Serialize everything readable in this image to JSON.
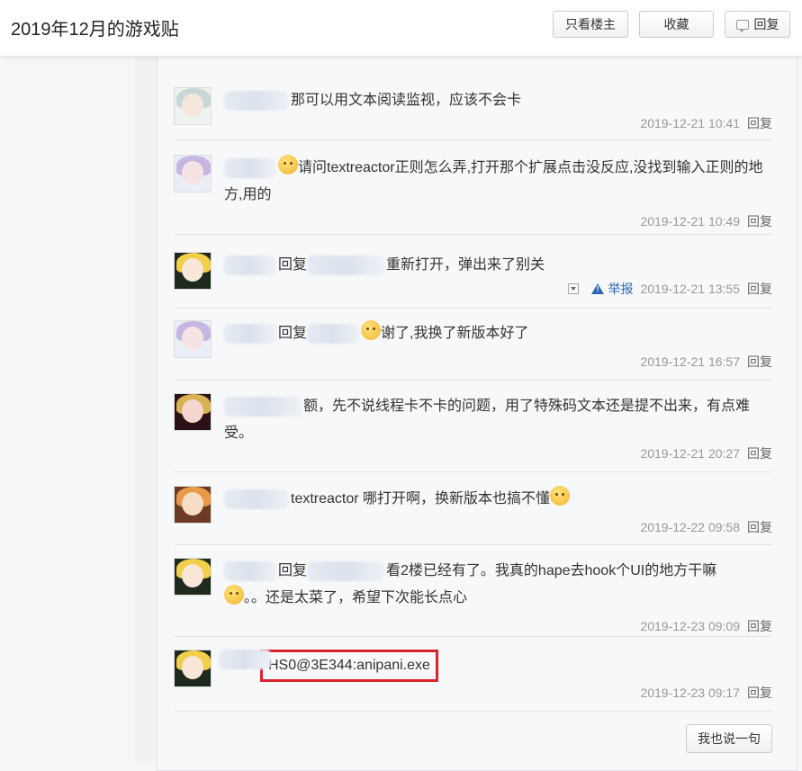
{
  "header": {
    "title": "2019年12月的游戏贴",
    "only_op_label": "只看楼主",
    "favorite_label": "收藏",
    "reply_label": "回复"
  },
  "colors": {
    "link_blue": "#2d64b3",
    "highlight_red": "#d9232d",
    "meta_gray": "#999999"
  },
  "replies": [
    {
      "text": "那可以用文本阅读监视，应该不会卡",
      "time": "2019-12-21 10:41",
      "reply_label": "回复",
      "avatar_icon": "avatar-silver-hair-icon"
    },
    {
      "text": "请问textreactor正则怎么弄,打开那个扩展点击没反应,没找到输入正则的地方,用的",
      "time": "2019-12-21 10:49",
      "reply_label": "回复",
      "avatar_icon": "avatar-purple-hair-icon",
      "emoji_icon": "sweat-emoji-icon"
    },
    {
      "prefix": "回复",
      "text": "重新打开，弹出来了别关",
      "time": "2019-12-21 13:55",
      "reply_label": "回复",
      "report_label": "举报",
      "avatar_icon": "avatar-blonde-hair-icon"
    },
    {
      "prefix": "回复",
      "text": "谢了,我换了新版本好了",
      "time": "2019-12-21 16:57",
      "reply_label": "回复",
      "avatar_icon": "avatar-purple-hair-icon",
      "emoji_icon": "tongue-emoji-icon"
    },
    {
      "text": "额，先不说线程卡不卡的问题，用了特殊码文本还是提不出来，有点难受。",
      "time": "2019-12-21 20:27",
      "reply_label": "回复",
      "avatar_icon": "avatar-red-hair-icon"
    },
    {
      "text": "textreactor 哪打开啊，换新版本也搞不懂",
      "time": "2019-12-22 09:58",
      "reply_label": "回复",
      "avatar_icon": "avatar-orange-hair-icon",
      "emoji_icon": "confused-emoji-icon"
    },
    {
      "prefix": "回复",
      "text": "看2楼已经有了。我真的hape去hook个UI的地方干嘛",
      "text2": "。。还是太菜了，希望下次能长点心",
      "time": "2019-12-23 09:09",
      "reply_label": "回复",
      "avatar_icon": "avatar-blonde-hair-icon",
      "emoji_icon": "crying-emoji-icon"
    },
    {
      "text": "HS0@3E344:anipani.exe",
      "time": "2019-12-23 09:17",
      "reply_label": "回复",
      "avatar_icon": "avatar-blonde-hair-icon"
    }
  ],
  "footer": {
    "say_label": "我也说一句"
  }
}
